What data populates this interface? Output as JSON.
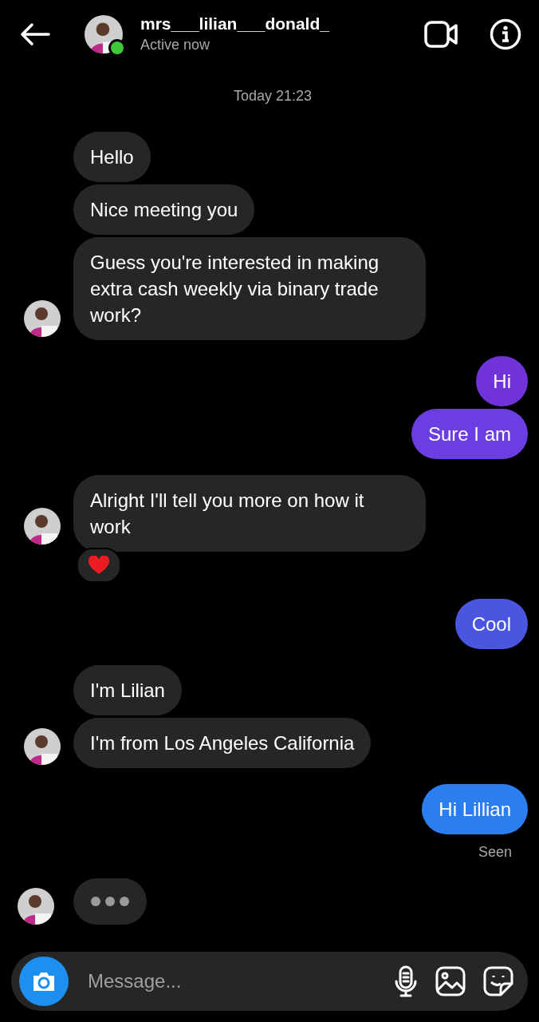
{
  "header": {
    "username": "mrs___lilian___donald_",
    "status": "Active now",
    "online": true
  },
  "timestamp": "Today 21:23",
  "groups": [
    {
      "outgoing": false,
      "bubbles": [
        {
          "text": "Hello"
        },
        {
          "text": "Nice meeting you"
        },
        {
          "text": "Guess you're interested in making extra cash weekly via binary trade work?"
        }
      ]
    },
    {
      "outgoing": true,
      "bubbles": [
        {
          "text": "Hi",
          "color": "#7033d9"
        },
        {
          "text": "Sure I am",
          "color": "#6a3ee0"
        }
      ]
    },
    {
      "outgoing": false,
      "bubbles": [
        {
          "text": "Alright I'll tell you more on how it work",
          "reacted": true
        }
      ]
    },
    {
      "outgoing": true,
      "bubbles": [
        {
          "text": "Cool",
          "color": "#4a55e0"
        }
      ]
    },
    {
      "outgoing": false,
      "bubbles": [
        {
          "text": "I'm Lilian"
        },
        {
          "text": "I'm from Los Angeles California"
        }
      ]
    },
    {
      "outgoing": true,
      "bubbles": [
        {
          "text": "Hi Lillian",
          "color": "#2a7ef0"
        }
      ],
      "receipt": "Seen"
    }
  ],
  "typing": true,
  "composer": {
    "placeholder": "Message..."
  }
}
